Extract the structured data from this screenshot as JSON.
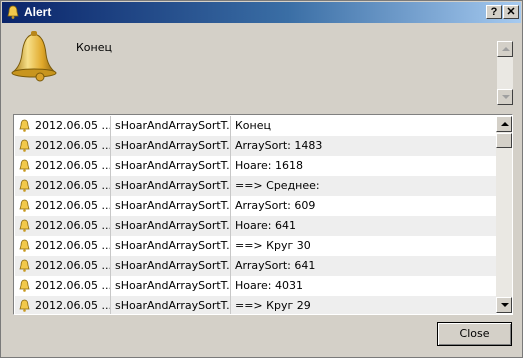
{
  "window": {
    "title": "Alert",
    "help_button": "?",
    "close_button": "✕"
  },
  "alert": {
    "message": "Конец"
  },
  "log": {
    "rows": [
      {
        "time": "2012.06.05 ...",
        "expert": "sHoarAndArraySortT...",
        "message": "Конец"
      },
      {
        "time": "2012.06.05 ...",
        "expert": "sHoarAndArraySortT...",
        "message": "ArraySort: 1483"
      },
      {
        "time": "2012.06.05 ...",
        "expert": "sHoarAndArraySortT...",
        "message": "Hoare: 1618"
      },
      {
        "time": "2012.06.05 ...",
        "expert": "sHoarAndArraySortT...",
        "message": "==> Среднее:"
      },
      {
        "time": "2012.06.05 ...",
        "expert": "sHoarAndArraySortT...",
        "message": "ArraySort: 609"
      },
      {
        "time": "2012.06.05 ...",
        "expert": "sHoarAndArraySortT...",
        "message": "Hoare: 641"
      },
      {
        "time": "2012.06.05 ...",
        "expert": "sHoarAndArraySortT...",
        "message": "==> Круг 30"
      },
      {
        "time": "2012.06.05 ...",
        "expert": "sHoarAndArraySortT...",
        "message": "ArraySort: 641"
      },
      {
        "time": "2012.06.05 ...",
        "expert": "sHoarAndArraySortT...",
        "message": "Hoare: 4031"
      },
      {
        "time": "2012.06.05 ...",
        "expert": "sHoarAndArraySortT...",
        "message": "==> Круг 29"
      }
    ]
  },
  "footer": {
    "close_label": "Close"
  },
  "icons": {
    "title": "bell-icon",
    "main": "bell-icon",
    "row": "bell-icon"
  },
  "colors": {
    "titlebar_start": "#0a246a",
    "titlebar_end": "#a6caf0",
    "bell_gold": "#e8b83a",
    "dialog_bg": "#d4d0c8"
  }
}
